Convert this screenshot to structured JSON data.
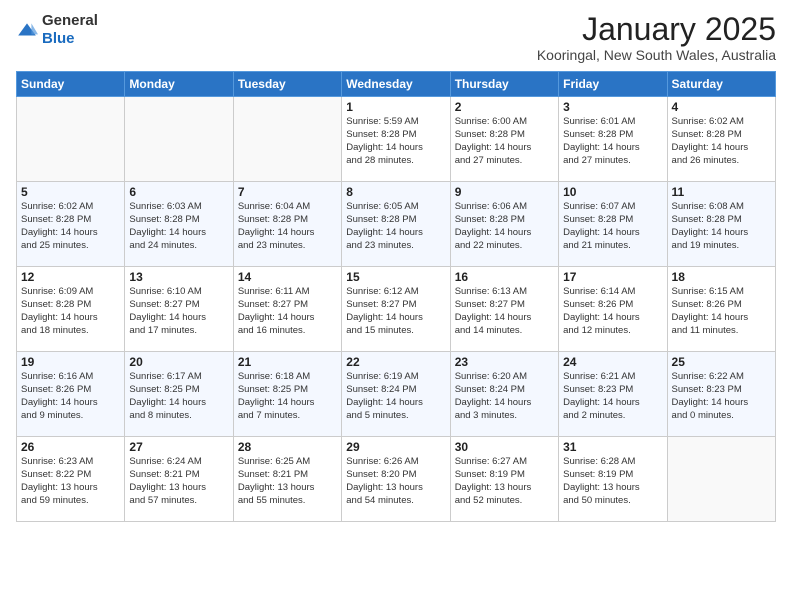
{
  "logo": {
    "general": "General",
    "blue": "Blue"
  },
  "title": "January 2025",
  "location": "Kooringal, New South Wales, Australia",
  "days_header": [
    "Sunday",
    "Monday",
    "Tuesday",
    "Wednesday",
    "Thursday",
    "Friday",
    "Saturday"
  ],
  "weeks": [
    [
      {
        "day": "",
        "info": ""
      },
      {
        "day": "",
        "info": ""
      },
      {
        "day": "",
        "info": ""
      },
      {
        "day": "1",
        "info": "Sunrise: 5:59 AM\nSunset: 8:28 PM\nDaylight: 14 hours\nand 28 minutes."
      },
      {
        "day": "2",
        "info": "Sunrise: 6:00 AM\nSunset: 8:28 PM\nDaylight: 14 hours\nand 27 minutes."
      },
      {
        "day": "3",
        "info": "Sunrise: 6:01 AM\nSunset: 8:28 PM\nDaylight: 14 hours\nand 27 minutes."
      },
      {
        "day": "4",
        "info": "Sunrise: 6:02 AM\nSunset: 8:28 PM\nDaylight: 14 hours\nand 26 minutes."
      }
    ],
    [
      {
        "day": "5",
        "info": "Sunrise: 6:02 AM\nSunset: 8:28 PM\nDaylight: 14 hours\nand 25 minutes."
      },
      {
        "day": "6",
        "info": "Sunrise: 6:03 AM\nSunset: 8:28 PM\nDaylight: 14 hours\nand 24 minutes."
      },
      {
        "day": "7",
        "info": "Sunrise: 6:04 AM\nSunset: 8:28 PM\nDaylight: 14 hours\nand 23 minutes."
      },
      {
        "day": "8",
        "info": "Sunrise: 6:05 AM\nSunset: 8:28 PM\nDaylight: 14 hours\nand 23 minutes."
      },
      {
        "day": "9",
        "info": "Sunrise: 6:06 AM\nSunset: 8:28 PM\nDaylight: 14 hours\nand 22 minutes."
      },
      {
        "day": "10",
        "info": "Sunrise: 6:07 AM\nSunset: 8:28 PM\nDaylight: 14 hours\nand 21 minutes."
      },
      {
        "day": "11",
        "info": "Sunrise: 6:08 AM\nSunset: 8:28 PM\nDaylight: 14 hours\nand 19 minutes."
      }
    ],
    [
      {
        "day": "12",
        "info": "Sunrise: 6:09 AM\nSunset: 8:28 PM\nDaylight: 14 hours\nand 18 minutes."
      },
      {
        "day": "13",
        "info": "Sunrise: 6:10 AM\nSunset: 8:27 PM\nDaylight: 14 hours\nand 17 minutes."
      },
      {
        "day": "14",
        "info": "Sunrise: 6:11 AM\nSunset: 8:27 PM\nDaylight: 14 hours\nand 16 minutes."
      },
      {
        "day": "15",
        "info": "Sunrise: 6:12 AM\nSunset: 8:27 PM\nDaylight: 14 hours\nand 15 minutes."
      },
      {
        "day": "16",
        "info": "Sunrise: 6:13 AM\nSunset: 8:27 PM\nDaylight: 14 hours\nand 14 minutes."
      },
      {
        "day": "17",
        "info": "Sunrise: 6:14 AM\nSunset: 8:26 PM\nDaylight: 14 hours\nand 12 minutes."
      },
      {
        "day": "18",
        "info": "Sunrise: 6:15 AM\nSunset: 8:26 PM\nDaylight: 14 hours\nand 11 minutes."
      }
    ],
    [
      {
        "day": "19",
        "info": "Sunrise: 6:16 AM\nSunset: 8:26 PM\nDaylight: 14 hours\nand 9 minutes."
      },
      {
        "day": "20",
        "info": "Sunrise: 6:17 AM\nSunset: 8:25 PM\nDaylight: 14 hours\nand 8 minutes."
      },
      {
        "day": "21",
        "info": "Sunrise: 6:18 AM\nSunset: 8:25 PM\nDaylight: 14 hours\nand 7 minutes."
      },
      {
        "day": "22",
        "info": "Sunrise: 6:19 AM\nSunset: 8:24 PM\nDaylight: 14 hours\nand 5 minutes."
      },
      {
        "day": "23",
        "info": "Sunrise: 6:20 AM\nSunset: 8:24 PM\nDaylight: 14 hours\nand 3 minutes."
      },
      {
        "day": "24",
        "info": "Sunrise: 6:21 AM\nSunset: 8:23 PM\nDaylight: 14 hours\nand 2 minutes."
      },
      {
        "day": "25",
        "info": "Sunrise: 6:22 AM\nSunset: 8:23 PM\nDaylight: 14 hours\nand 0 minutes."
      }
    ],
    [
      {
        "day": "26",
        "info": "Sunrise: 6:23 AM\nSunset: 8:22 PM\nDaylight: 13 hours\nand 59 minutes."
      },
      {
        "day": "27",
        "info": "Sunrise: 6:24 AM\nSunset: 8:21 PM\nDaylight: 13 hours\nand 57 minutes."
      },
      {
        "day": "28",
        "info": "Sunrise: 6:25 AM\nSunset: 8:21 PM\nDaylight: 13 hours\nand 55 minutes."
      },
      {
        "day": "29",
        "info": "Sunrise: 6:26 AM\nSunset: 8:20 PM\nDaylight: 13 hours\nand 54 minutes."
      },
      {
        "day": "30",
        "info": "Sunrise: 6:27 AM\nSunset: 8:19 PM\nDaylight: 13 hours\nand 52 minutes."
      },
      {
        "day": "31",
        "info": "Sunrise: 6:28 AM\nSunset: 8:19 PM\nDaylight: 13 hours\nand 50 minutes."
      },
      {
        "day": "",
        "info": ""
      }
    ]
  ]
}
